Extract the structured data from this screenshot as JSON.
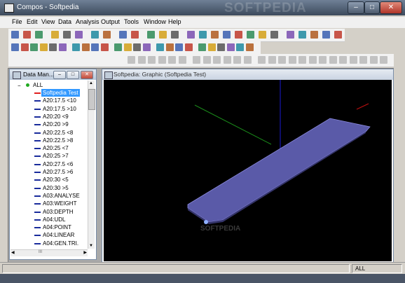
{
  "window": {
    "title": "Compos - Softpedia",
    "watermark": "SOFTPEDIA"
  },
  "menu": [
    "File",
    "Edit",
    "View",
    "Data",
    "Analysis",
    "Output",
    "Tools",
    "Window",
    "Help"
  ],
  "toolbar": {
    "row1_icons": [
      "new-icon",
      "open-icon",
      "save-icon",
      "cut-icon",
      "copy-icon",
      "paste-icon",
      "print-icon",
      "print-preview-icon",
      "help-icon",
      "context-help-icon",
      "font-icon",
      "units-icon",
      "format-icon",
      "tool-a-icon",
      "tool-b-icon",
      "tool-c-icon",
      "tool-d-icon",
      "tool-e-icon",
      "tool-f-icon",
      "tool-g-icon",
      "tool-h-icon",
      "table-a-icon",
      "table-b-icon",
      "table-c-icon",
      "table-d-icon",
      "table-e-icon"
    ],
    "row2_icons": [
      "beam-icon",
      "deck-icon",
      "section-a-icon",
      "section-b-icon",
      "section-c-icon",
      "section-d-icon",
      "list-a-icon",
      "list-b-icon",
      "list-c-icon",
      "list-d-icon",
      "arrow-icon",
      "gauge-icon",
      "grid-a-icon",
      "grid-b-icon",
      "copy-icon",
      "zoom-icon",
      "rotate-icon",
      "measure-icon",
      "view-a-icon",
      "view-b-icon",
      "view-c-icon",
      "view-d-icon",
      "edit-a-icon",
      "edit-b-icon"
    ],
    "row3_icons": [
      "b1-icon",
      "b2-icon",
      "b3-icon",
      "b4-icon",
      "b5-icon",
      "b6-icon",
      "c1-icon",
      "c2-icon",
      "c3-icon",
      "c4-icon",
      "c5-icon",
      "c6-icon",
      "c7-icon",
      "c8-icon",
      "c9-icon",
      "c10-icon",
      "c11-icon",
      "c12-icon",
      "c13-icon",
      "c14-icon",
      "c15-icon",
      "c16-icon",
      "c17-icon",
      "c18-icon",
      "c19-icon"
    ]
  },
  "data_manager": {
    "title": "Data Man...",
    "root": "ALL",
    "items": [
      "Softpedia Test",
      "A20:17.5 <10",
      "A20:17.5 >10",
      "A20:20 <9",
      "A20:20 >9",
      "A20:22.5 <8",
      "A20:22.5 >8",
      "A20:25 <7",
      "A20:25 >7",
      "A20:27.5 <6",
      "A20:27.5 >6",
      "A20:30 <5",
      "A20:30 >5",
      "A03:ANALYSE",
      "A03:WEIGHT",
      "A03:DEPTH",
      "A04:UDL",
      "A04:POINT",
      "A04:LINEAR",
      "A04:GEN.TRI."
    ],
    "selected_index": 0,
    "scroll_label": "III"
  },
  "graphic": {
    "title": "Softpedia: Graphic (Softpedia Test)",
    "plate_color": "#5a5aa8",
    "axis_colors": {
      "x": "#c01010",
      "y": "#1a8a1a",
      "z": "#1a1ad0"
    },
    "watermark": "SOFTPEDIA"
  },
  "status": {
    "left": "",
    "right": "ALL"
  }
}
